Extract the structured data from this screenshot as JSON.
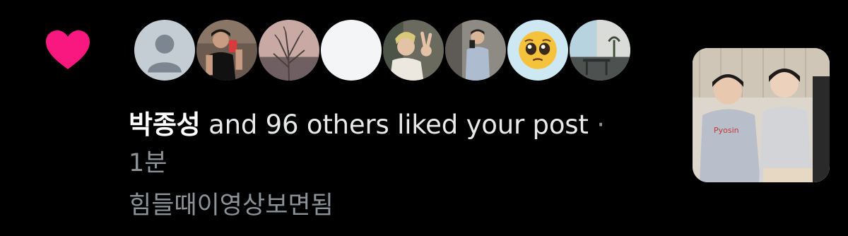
{
  "notification": {
    "type": "like",
    "icon": "heart-icon",
    "icon_color": "#f91880",
    "username": "박종성",
    "action_text": "and 96 others liked your post",
    "separator": "·",
    "timestamp": "1분",
    "post_text": "힘들때이영상보면됨"
  },
  "avatars": [
    {
      "name": "default-avatar"
    },
    {
      "name": "user-avatar-mirror-selfie"
    },
    {
      "name": "user-avatar-landscape"
    },
    {
      "name": "user-avatar-blank"
    },
    {
      "name": "user-avatar-peace-sign"
    },
    {
      "name": "user-avatar-mirror-selfie-2"
    },
    {
      "name": "user-avatar-pleading-emoji"
    },
    {
      "name": "user-avatar-interior"
    }
  ],
  "post_thumbnail": {
    "name": "post-thumbnail-two-people-hoodies"
  }
}
